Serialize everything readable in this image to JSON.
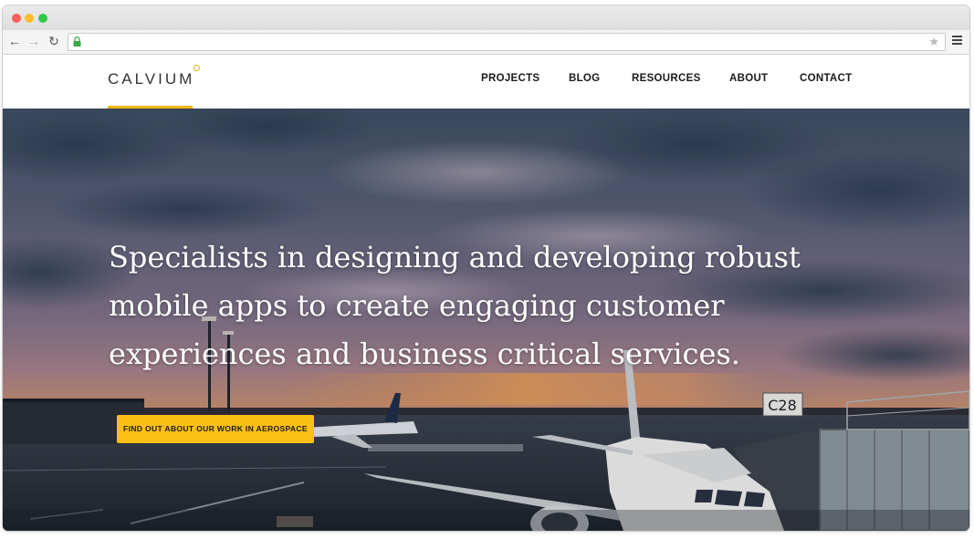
{
  "browser": {
    "back_icon": "arrow-left-icon",
    "forward_icon": "arrow-right-icon",
    "reload_icon": "reload-icon",
    "lock_icon": "lock-icon",
    "bookmark_icon": "star-icon",
    "menu_icon": "hamburger-menu-icon",
    "address_value": ""
  },
  "site": {
    "logo_text": "CALVIUM",
    "nav": [
      {
        "label": "PROJECTS"
      },
      {
        "label": "BLOG"
      },
      {
        "label": "RESOURCES"
      },
      {
        "label": "ABOUT"
      },
      {
        "label": "CONTACT"
      }
    ]
  },
  "hero": {
    "headline": "Specialists in designing and developing robust mobile apps to create engaging customer experiences and business critical services.",
    "cta_label": "FIND OUT ABOUT OUR WORK IN AEROSPACE",
    "gate_sign": "C28"
  },
  "colors": {
    "accent": "#fbbf16",
    "nav_text": "#1a1a1a",
    "hero_text": "#ffffff"
  }
}
